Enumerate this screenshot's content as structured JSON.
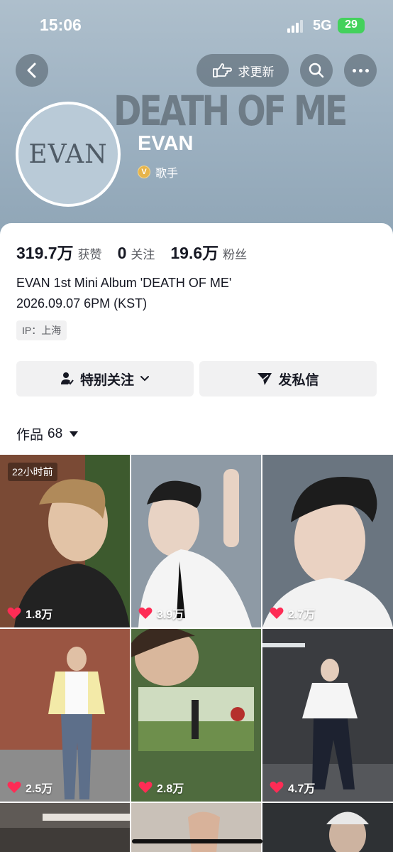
{
  "status_bar": {
    "time": "15:06",
    "network": "5G",
    "battery": "29"
  },
  "header": {
    "banner_text": "DEATH OF ME",
    "update_button_label": "求更新"
  },
  "profile": {
    "avatar_text": "EVAN",
    "name": "EVAN",
    "badge_letter": "V",
    "role": "歌手"
  },
  "stats": [
    {
      "value": "319.7万",
      "label": "获赞"
    },
    {
      "value": "0",
      "label": "关注"
    },
    {
      "value": "19.6万",
      "label": "粉丝"
    }
  ],
  "bio": {
    "line1": "EVAN 1st Mini Album 'DEATH OF ME'",
    "line2": "2026.09.07 6PM (KST)"
  },
  "ip_location": "IP：上海",
  "actions": {
    "follow_label": "特别关注",
    "message_label": "发私信"
  },
  "works": {
    "label": "作品",
    "count": "68"
  },
  "posts": [
    {
      "likes": "1.8万",
      "time": "22小时前",
      "bg": "#6b5a48"
    },
    {
      "likes": "3.9万",
      "bg": "#9aa4ae"
    },
    {
      "likes": "2.7万",
      "bg": "#5a6570"
    },
    {
      "likes": "2.5万",
      "bg": "#8a4f3e"
    },
    {
      "likes": "2.8万",
      "bg": "#5d7a4a"
    },
    {
      "likes": "4.7万",
      "bg": "#3b3d42"
    },
    {
      "likes": "",
      "bg": "#5f5a56"
    },
    {
      "likes": "",
      "bg": "#b9b2aa"
    },
    {
      "likes": "",
      "bg": "#2e3134"
    }
  ],
  "colors": {
    "like_heart": "#fe2c55",
    "battery": "#43d15c"
  }
}
